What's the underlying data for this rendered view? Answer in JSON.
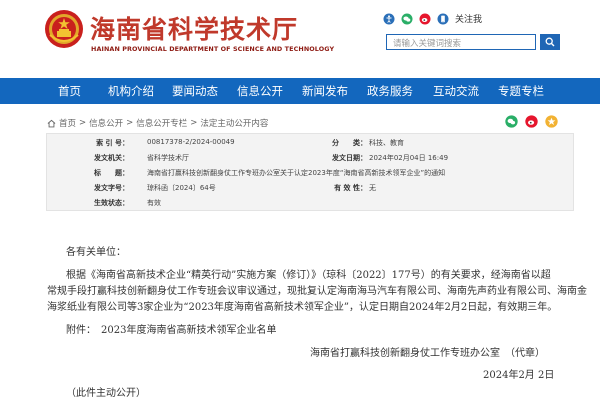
{
  "header": {
    "title_cn": "海南省科学技术厅",
    "title_en": "HAINAN PROVINCIAL DEPARTMENT OF SCIENCE AND TECHNOLOGY",
    "follow_label": "关注我",
    "search_placeholder": "请输入关键词搜索"
  },
  "nav": {
    "items": [
      "首页",
      "机构介绍",
      "要闻动态",
      "信息公开",
      "新闻发布",
      "政务服务",
      "互动交流",
      "专题专栏"
    ]
  },
  "breadcrumb": {
    "items": [
      "首页",
      "信息公开",
      "信息公开专栏",
      "法定主动公开内容"
    ],
    "sep": ">"
  },
  "meta": {
    "index_label": "索 引 号：",
    "index_value": "00817378-2/2024-00049",
    "category_label": "分　　类：",
    "category_value": "科技、教育",
    "issuer_label": "发文机关：",
    "issuer_value": "省科学技术厅",
    "date_label": "发文日期：",
    "date_value": "2024年02月04日 16:49",
    "title_label": "标　　题：",
    "title_value": "海南省打赢科技创新翻身仗工作专班办公室关于认定2023年度“海南省高新技术领军企业”的通知",
    "docno_label": "发文字号：",
    "docno_value": "琼科函〔2024〕64号",
    "status_label": "有 效 性：",
    "status_value": "无",
    "validity_label": "生效状态：",
    "validity_value": "有效"
  },
  "article": {
    "salutation": "各有关单位：",
    "para1_line1": "根据《海南省高新技术企业“精英行动”实施方案（修订）》（琼科〔2022〕177号）的有关要求，经海南省以超",
    "para1_line2": "常规手段打赢科技创新翻身仗工作专班会议审议通过，现批复认定海南海马汽车有限公司、海南先声药业有限公司、海南金",
    "para1_line3": "海浆纸业有限公司等3家企业为“2023年度海南省高新技术领军企业”，认定日期自2024年2月2日起，有效期三年。",
    "attachment": "附件：　2023年度海南省高新技术领军企业名单",
    "signature": "海南省打赢科技创新翻身仗工作专班办公室　（代章）",
    "sign_date": "2024年2月 2日",
    "note": "（此件主动公开）"
  },
  "colors": {
    "brand_red": "#c0392b",
    "nav_blue": "#1367be",
    "link_blue": "#1f66b5"
  }
}
